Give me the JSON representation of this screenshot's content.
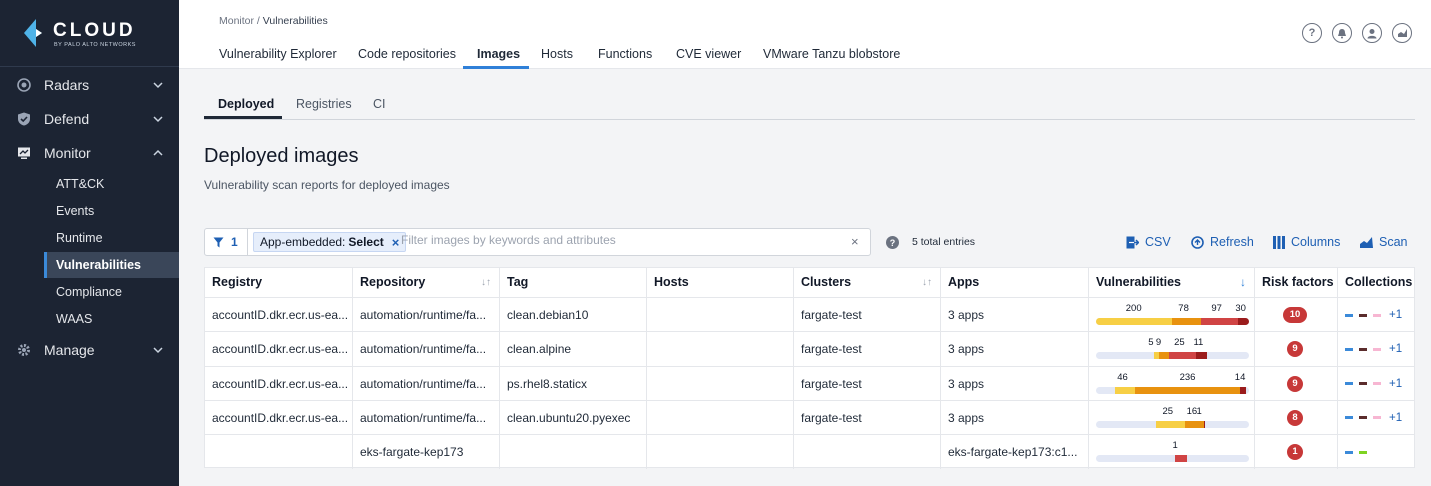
{
  "brand": {
    "name": "CLOUD",
    "sub": "BY PALO ALTO NETWORKS"
  },
  "sidebar": {
    "items": [
      {
        "label": "Radars",
        "icon": "radar-icon"
      },
      {
        "label": "Defend",
        "icon": "shield-icon"
      },
      {
        "label": "Monitor",
        "icon": "monitor-icon"
      },
      {
        "label": "Manage",
        "icon": "gear-icon"
      }
    ],
    "monitor_subitems": [
      "ATT&CK",
      "Events",
      "Runtime",
      "Vulnerabilities",
      "Compliance",
      "WAAS"
    ]
  },
  "header": {
    "breadcrumb_root": "Monitor /",
    "breadcrumb_current": "Vulnerabilities",
    "tabs": [
      "Vulnerability Explorer",
      "Code repositories",
      "Images",
      "Hosts",
      "Functions",
      "CVE viewer",
      "VMware Tanzu blobstore"
    ],
    "active_tab": "Images"
  },
  "subtabs": [
    "Deployed",
    "Registries",
    "CI"
  ],
  "page": {
    "title": "Deployed images",
    "subtitle": "Vulnerability scan reports for deployed images"
  },
  "filter": {
    "count": "1",
    "chip_key": "App-embedded:",
    "chip_value": "Select",
    "placeholder": "Filter images by keywords and attributes",
    "clear": "×"
  },
  "entries": "5 total entries",
  "toolbar": {
    "csv": "CSV",
    "refresh": "Refresh",
    "columns": "Columns",
    "scan": "Scan"
  },
  "table": {
    "columns": [
      "Registry",
      "Repository",
      "Tag",
      "Hosts",
      "Clusters",
      "Apps",
      "Vulnerabilities",
      "Risk factors",
      "Collections"
    ],
    "rows": [
      {
        "registry": "accountID.dkr.ecr.us-ea...",
        "repository": "automation/runtime/fa...",
        "tag": "clean.debian10",
        "hosts": "",
        "clusters": "fargate-test",
        "apps": "3 apps",
        "vulns": {
          "critical": 30,
          "high": 97,
          "medium": 78,
          "low": 200
        },
        "risk": "10",
        "collections": [
          "#3b8ad9",
          "#5b2c2c",
          "#f7b6d2"
        ],
        "more": "+1"
      },
      {
        "registry": "accountID.dkr.ecr.us-ea...",
        "repository": "automation/runtime/fa...",
        "tag": "clean.alpine",
        "hosts": "",
        "clusters": "fargate-test",
        "apps": "3 apps",
        "vulns": {
          "critical": 11,
          "high": 25,
          "medium": 9,
          "low": 5
        },
        "risk": "9",
        "collections": [
          "#3b8ad9",
          "#5b2c2c",
          "#f7b6d2"
        ],
        "more": "+1"
      },
      {
        "registry": "accountID.dkr.ecr.us-ea...",
        "repository": "automation/runtime/fa...",
        "tag": "ps.rhel8.staticx",
        "hosts": "",
        "clusters": "fargate-test",
        "apps": "3 apps",
        "vulns": {
          "critical": 14,
          "high": 0,
          "medium": 236,
          "low": 46
        },
        "risk": "9",
        "collections": [
          "#3b8ad9",
          "#5b2c2c",
          "#f7b6d2"
        ],
        "more": "+1"
      },
      {
        "registry": "accountID.dkr.ecr.us-ea...",
        "repository": "automation/runtime/fa...",
        "tag": "clean.ubuntu20.pyexec",
        "hosts": "",
        "clusters": "fargate-test",
        "apps": "3 apps",
        "vulns": {
          "critical": 1,
          "high": 0,
          "medium": 16,
          "low": 25
        },
        "risk": "8",
        "collections": [
          "#3b8ad9",
          "#5b2c2c",
          "#f7b6d2"
        ],
        "more": "+1"
      },
      {
        "registry": "",
        "repository": "eks-fargate-kep173",
        "tag": "",
        "hosts": "",
        "clusters": "",
        "apps": "eks-fargate-kep173:c1...",
        "vulns": {
          "critical": 0,
          "high": 1,
          "medium": 0,
          "low": 0
        },
        "risk": "1",
        "collections": [
          "#3b8ad9",
          "#7ed321"
        ],
        "more": ""
      }
    ]
  },
  "colors": {
    "critical": "#9b1c1c",
    "high": "#d04444",
    "medium": "#e8920f",
    "low": "#f7cf45",
    "accent": "#2f80d8"
  }
}
